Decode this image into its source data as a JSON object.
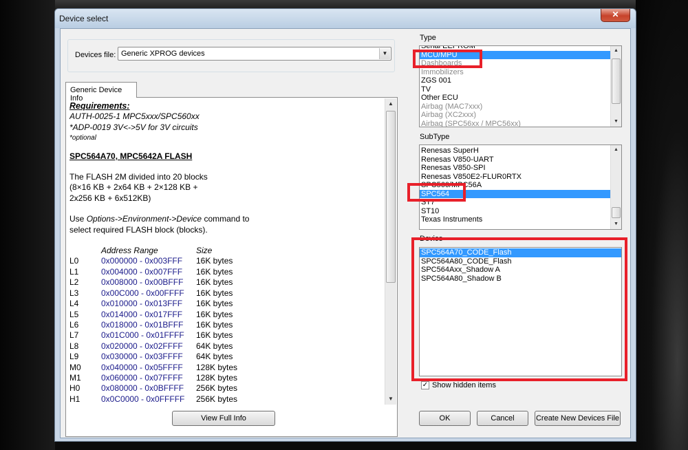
{
  "window": {
    "title": "Device select",
    "close_glyph": "✕"
  },
  "devices_file": {
    "label": "Devices file:",
    "value": "Generic XPROG devices"
  },
  "info": {
    "tab_label": "Generic Device Info",
    "requirements_title": "Requirements:",
    "req_lines": [
      "AUTH-0025-1 MPC5xxx/SPC560xx",
      "*ADP-0019 3V<->5V for 3V circuits"
    ],
    "optional_note": "*optional",
    "flash_title": "SPC564A70, MPC5642A FLASH",
    "para1": [
      "The FLASH 2M divided into 20 blocks",
      "(8×16 KB + 2x64 KB +  2×128 KB +",
      "2x256 KB + 6x512KB)"
    ],
    "para2_parts": [
      "Use ",
      "Options->Environment->Device",
      " command to"
    ],
    "para2_line2": "select required FLASH block (blocks).",
    "table_headers": {
      "range": "Address Range",
      "size": "Size"
    },
    "blocks": [
      {
        "name": "L0",
        "range": "0x000000 - 0x003FFF",
        "size": "16K bytes"
      },
      {
        "name": "L1",
        "range": "0x004000 - 0x007FFF",
        "size": "16K bytes"
      },
      {
        "name": "L2",
        "range": "0x008000 - 0x00BFFF",
        "size": "16K bytes"
      },
      {
        "name": "L3",
        "range": "0x00C000 - 0x00FFFF",
        "size": "16K bytes"
      },
      {
        "name": "L4",
        "range": "0x010000 - 0x013FFF",
        "size": "16K bytes"
      },
      {
        "name": "L5",
        "range": "0x014000 - 0x017FFF",
        "size": "16K bytes"
      },
      {
        "name": "L6",
        "range": "0x018000 - 0x01BFFF",
        "size": "16K bytes"
      },
      {
        "name": "L7",
        "range": "0x01C000 - 0x01FFFF",
        "size": "16K bytes"
      },
      {
        "name": "L8",
        "range": "0x020000 - 0x02FFFF",
        "size": "64K bytes"
      },
      {
        "name": "L9",
        "range": "0x030000 - 0x03FFFF",
        "size": "64K bytes"
      },
      {
        "name": "M0",
        "range": "0x040000 - 0x05FFFF",
        "size": "128K bytes"
      },
      {
        "name": "M1",
        "range": "0x060000 - 0x07FFFF",
        "size": "128K bytes"
      },
      {
        "name": "H0",
        "range": "0x080000 - 0x0BFFFF",
        "size": "256K bytes"
      },
      {
        "name": "H1",
        "range": "0x0C0000 - 0x0FFFFF",
        "size": "256K bytes"
      }
    ],
    "view_full_info": "View Full Info"
  },
  "type_list": {
    "label": "Type",
    "items": [
      {
        "label": "Serial EEPROM",
        "selected": false,
        "dim": false
      },
      {
        "label": "MCU/MPU",
        "selected": true,
        "dim": false
      },
      {
        "label": "Dashboards",
        "selected": false,
        "dim": true
      },
      {
        "label": "Immobilizers",
        "selected": false,
        "dim": true
      },
      {
        "label": "ZGS 001",
        "selected": false,
        "dim": false
      },
      {
        "label": "TV",
        "selected": false,
        "dim": false
      },
      {
        "label": "Other ECU",
        "selected": false,
        "dim": false
      },
      {
        "label": "Airbag (MAC7xxx)",
        "selected": false,
        "dim": true
      },
      {
        "label": "Airbag (XC2xxx)",
        "selected": false,
        "dim": true
      },
      {
        "label": "Airbag (SPC56xx / MPC56xx)",
        "selected": false,
        "dim": true
      }
    ]
  },
  "subtype_list": {
    "label": "SubType",
    "items": [
      {
        "label": "Renesas SuperH",
        "selected": false
      },
      {
        "label": "Renesas V850-UART",
        "selected": false
      },
      {
        "label": "Renesas V850-SPI",
        "selected": false
      },
      {
        "label": "Renesas V850E2-FLUR0RTX",
        "selected": false
      },
      {
        "label": "SPC560/MPC56A",
        "selected": false
      },
      {
        "label": "SPC564",
        "selected": true
      },
      {
        "label": "ST7",
        "selected": false
      },
      {
        "label": "ST10",
        "selected": false
      },
      {
        "label": "Texas Instruments",
        "selected": false
      }
    ]
  },
  "device_list": {
    "label": "Device",
    "items": [
      {
        "label": "SPC564A70_CODE_Flash",
        "selected": true
      },
      {
        "label": "SPC564A80_CODE_Flash",
        "selected": false
      },
      {
        "label": "SPC564Axx_Shadow A",
        "selected": false
      },
      {
        "label": "SPC564A80_Shadow B",
        "selected": false
      }
    ]
  },
  "show_hidden": {
    "label": "Show hidden items",
    "checked": true,
    "check_glyph": "✓"
  },
  "buttons": {
    "ok": "OK",
    "cancel": "Cancel",
    "create": "Create New Devices File"
  },
  "highlight_color": "#e8202a",
  "selection_color": "#3399ff"
}
